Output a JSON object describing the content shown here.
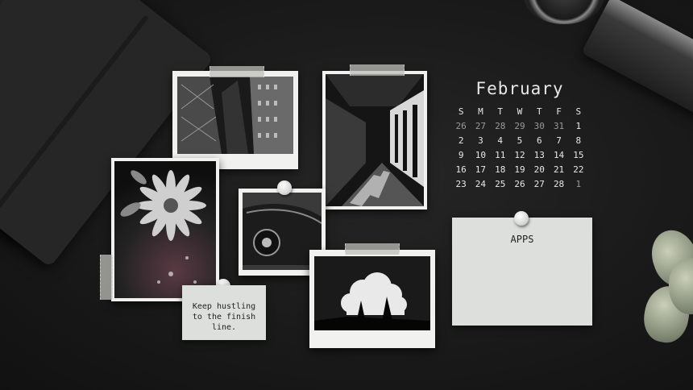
{
  "calendar": {
    "month": "February",
    "weekdays": [
      "S",
      "M",
      "T",
      "W",
      "T",
      "F",
      "S"
    ],
    "days": [
      {
        "d": "26",
        "muted": true
      },
      {
        "d": "27",
        "muted": true
      },
      {
        "d": "28",
        "muted": true
      },
      {
        "d": "29",
        "muted": true
      },
      {
        "d": "30",
        "muted": true
      },
      {
        "d": "31",
        "muted": true
      },
      {
        "d": "1",
        "muted": false
      },
      {
        "d": "2",
        "muted": false
      },
      {
        "d": "3",
        "muted": false
      },
      {
        "d": "4",
        "muted": false
      },
      {
        "d": "5",
        "muted": false
      },
      {
        "d": "6",
        "muted": false
      },
      {
        "d": "7",
        "muted": false
      },
      {
        "d": "8",
        "muted": false
      },
      {
        "d": "9",
        "muted": false
      },
      {
        "d": "10",
        "muted": false
      },
      {
        "d": "11",
        "muted": false
      },
      {
        "d": "12",
        "muted": false
      },
      {
        "d": "13",
        "muted": false
      },
      {
        "d": "14",
        "muted": false
      },
      {
        "d": "15",
        "muted": false
      },
      {
        "d": "16",
        "muted": false
      },
      {
        "d": "17",
        "muted": false
      },
      {
        "d": "18",
        "muted": false
      },
      {
        "d": "19",
        "muted": false
      },
      {
        "d": "20",
        "muted": false
      },
      {
        "d": "21",
        "muted": false
      },
      {
        "d": "22",
        "muted": false
      },
      {
        "d": "23",
        "muted": false
      },
      {
        "d": "24",
        "muted": false
      },
      {
        "d": "25",
        "muted": false
      },
      {
        "d": "26",
        "muted": false
      },
      {
        "d": "27",
        "muted": false
      },
      {
        "d": "28",
        "muted": false
      },
      {
        "d": "1",
        "muted": true
      }
    ]
  },
  "notes": {
    "quote_line1": "Keep hustling",
    "quote_line2": "to the finish",
    "quote_line3": "line.",
    "apps_label": "APPS"
  }
}
